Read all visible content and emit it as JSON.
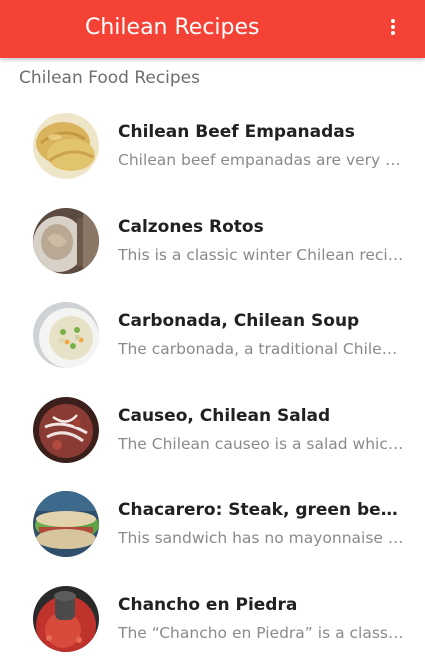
{
  "app_bar": {
    "title": "Chilean Recipes",
    "color": "#f44336",
    "menu_icon": "more-vert-icon"
  },
  "section_header": "Chilean Food Recipes",
  "recipes": [
    {
      "title": "Chilean Beef Empanadas",
      "description": "Chilean beef empanadas are very sim..."
    },
    {
      "title": "Calzones Rotos",
      "description": "This is a classic winter Chilean recipe..."
    },
    {
      "title": "Carbonada, Chilean Soup",
      "description": "The carbonada, a traditional Chilean ..."
    },
    {
      "title": "Causeo, Chilean Salad",
      "description": "The Chilean causeo is a salad which t..."
    },
    {
      "title": "Chacarero: Steak, green beans, t...",
      "description": "This sandwich has no mayonnaise or..."
    },
    {
      "title": "Chancho en Piedra",
      "description": "The “Chancho en Piedra” is a classic ..."
    }
  ]
}
